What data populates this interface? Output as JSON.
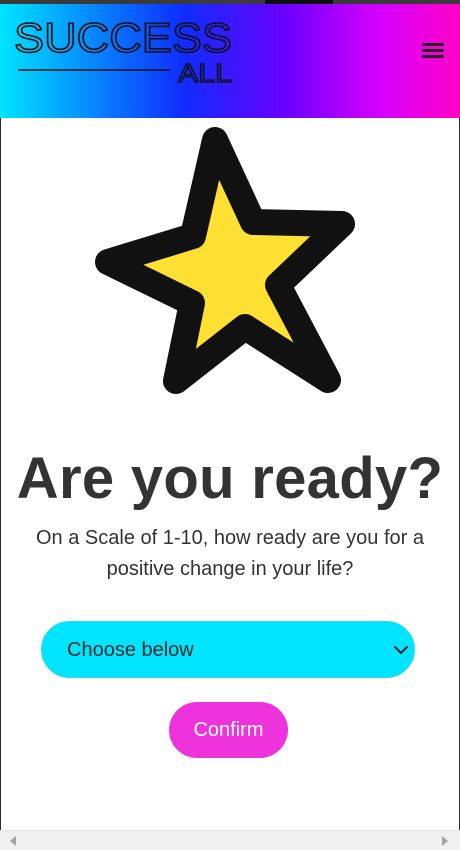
{
  "header": {
    "logo_line1": "SUCCESS",
    "logo_line2": "ALL",
    "menu_icon": "hamburger-menu-icon"
  },
  "hero": {
    "icon": "star-icon",
    "star_fill": "#ffe033",
    "star_stroke": "#111111"
  },
  "main": {
    "title": "Are you ready?",
    "subtitle": "On a Scale of 1-10, how ready are you for a positive change in your life?",
    "select": {
      "selected": "Choose below",
      "icon": "chevron-down-icon"
    },
    "confirm_label": "Confirm"
  },
  "colors": {
    "select_bg": "#00e5ff",
    "confirm_bg": "#ee33dd",
    "header_gradient": [
      "#00e5ff",
      "#0f2cff",
      "#6a00ff",
      "#d400ff",
      "#ff00c8"
    ]
  }
}
